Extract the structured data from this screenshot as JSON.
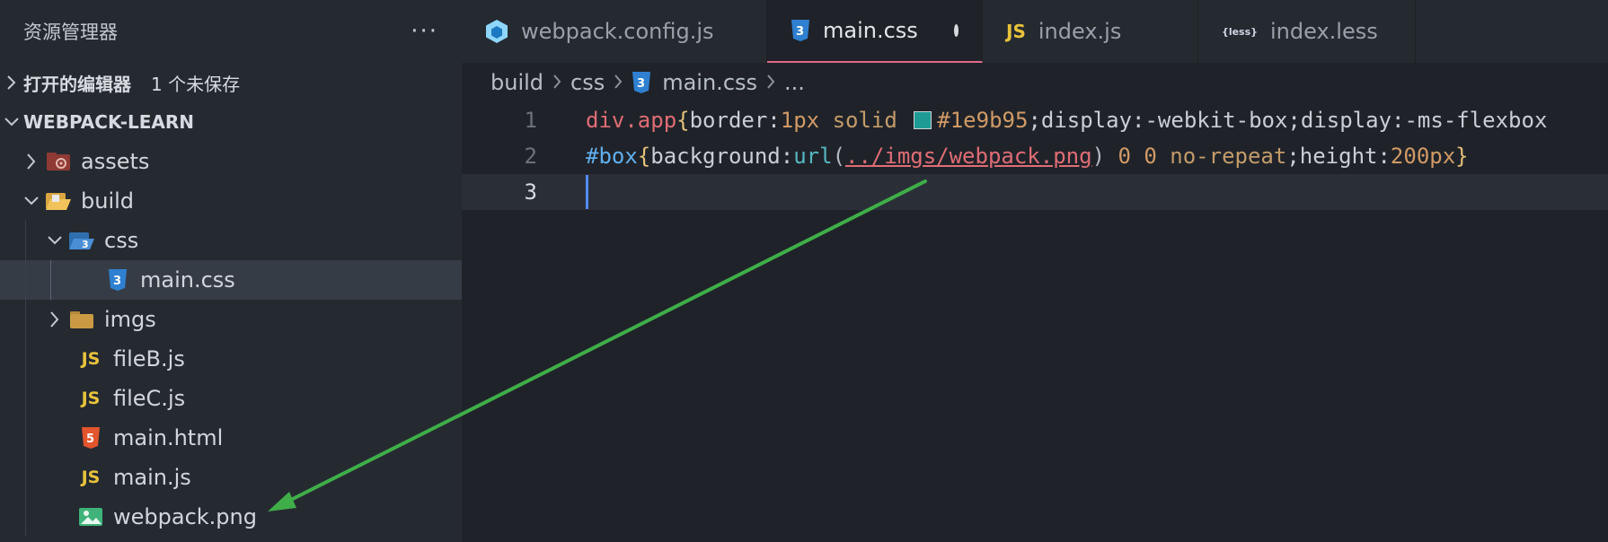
{
  "sidebar": {
    "title": "资源管理器",
    "more": "···",
    "open_editors": {
      "label": "打开的编辑器",
      "badge": "1 个未保存"
    },
    "project": "WEBPACK-LEARN",
    "tree": {
      "assets": "assets",
      "build": "build",
      "css": "css",
      "main_css": "main.css",
      "imgs": "imgs",
      "fileB": "fileB.js",
      "fileC": "fileC.js",
      "main_html": "main.html",
      "main_js": "main.js",
      "webpack_png": "webpack.png"
    }
  },
  "tabs": {
    "t1": "webpack.config.js",
    "t2": "main.css",
    "t3": "index.js",
    "t4": "index.less"
  },
  "icons": {
    "js_text": "JS",
    "less_text": "{less}"
  },
  "breadcrumb": {
    "p1": "build",
    "p2": "css",
    "p3": "main.css",
    "p4": "..."
  },
  "code": {
    "line_numbers": [
      "1",
      "2",
      "3"
    ],
    "line1": {
      "sel": "div.app",
      "b1": "{",
      "prop1": "border:",
      "num1": "1px",
      "kw1": " solid ",
      "color": "#1e9b95",
      "rest": ";display:-webkit-box;display:-ms-flexbox"
    },
    "line2": {
      "sel": "#box",
      "b1": "{",
      "prop1": "background:",
      "fn": "url",
      "p_open": "(",
      "str": "../imgs/webpack.png",
      "p_close": ")",
      "n1": " 0 0 ",
      "kw": "no-repeat",
      "semi": ";",
      "prop2": "height:",
      "num2": "200px",
      "b2": "}"
    }
  },
  "colors": {
    "arrow": "#3fae49",
    "swatch": "#1e9b95",
    "accent": "#528bff"
  }
}
